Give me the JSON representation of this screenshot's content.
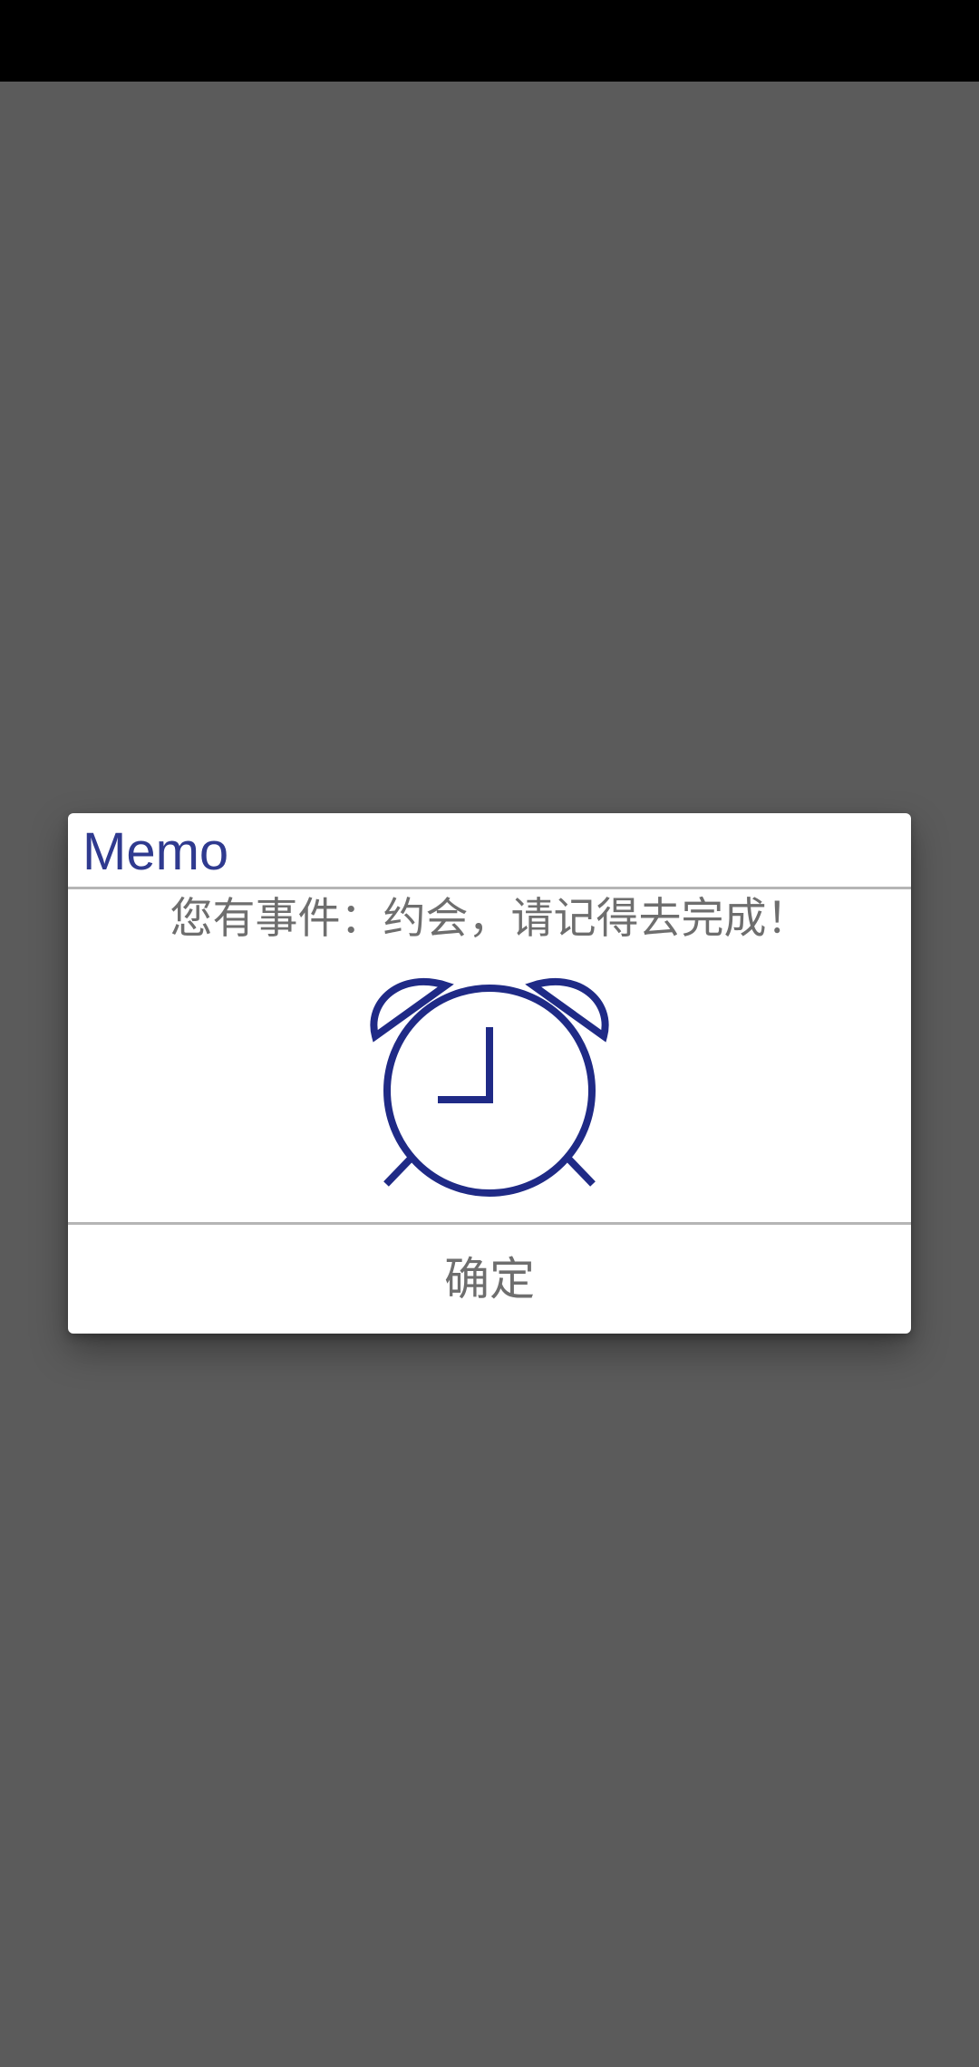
{
  "dialog": {
    "title": "Memo",
    "message": "您有事件：约会，请记得去完成！",
    "icon": "alarm-clock-icon",
    "confirm_label": "确定"
  },
  "colors": {
    "title": "#2f3a8f",
    "icon_stroke": "#1f2a86",
    "scrim": "#5b5b5b",
    "status_bar": "#000000"
  }
}
